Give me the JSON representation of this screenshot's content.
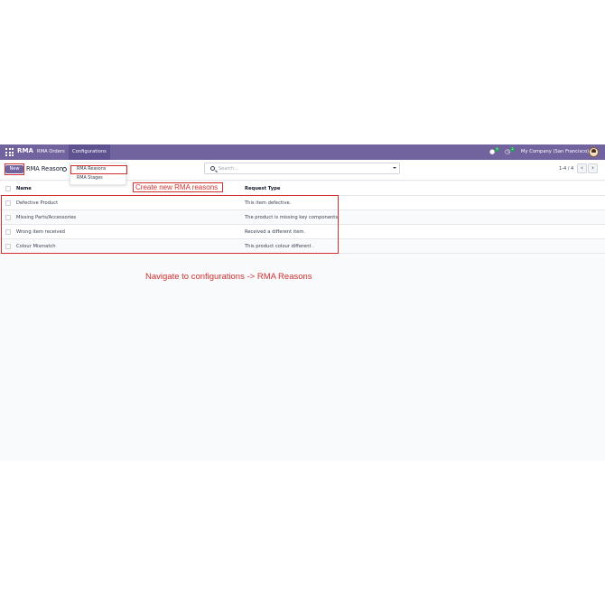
{
  "navbar": {
    "brand": "RMA",
    "menu": [
      "RMA Orders",
      "Configurations"
    ],
    "activity_count": "5",
    "timer_count": "2",
    "company": "My Company (San Francisco)"
  },
  "control_panel": {
    "new_label": "New",
    "breadcrumb": "RMA Reason",
    "search_placeholder": "Search...",
    "pager": "1-4 / 4",
    "prev": "‹",
    "next": "›"
  },
  "configurations_menu": [
    "RMA Reasons",
    "RMA Stages"
  ],
  "table": {
    "columns": [
      "Name",
      "Request Type"
    ],
    "rows": [
      {
        "name": "Defective Product",
        "request_type": "This item defective."
      },
      {
        "name": "Missing Parts/Accessories",
        "request_type": "The product is missing key components."
      },
      {
        "name": "Wrong item received",
        "request_type": "Received a different item."
      },
      {
        "name": "Colour Mismatch",
        "request_type": "This product colour different ."
      }
    ]
  },
  "annotations": {
    "create_hint": "Create new RMA reasons",
    "navigate_hint": "Navigate to configurations -> RMA Reasons",
    "color": "#d32f2f"
  },
  "colors": {
    "brand": "#71639e",
    "brand_active": "#5f5290",
    "badge": "#22a35b"
  }
}
